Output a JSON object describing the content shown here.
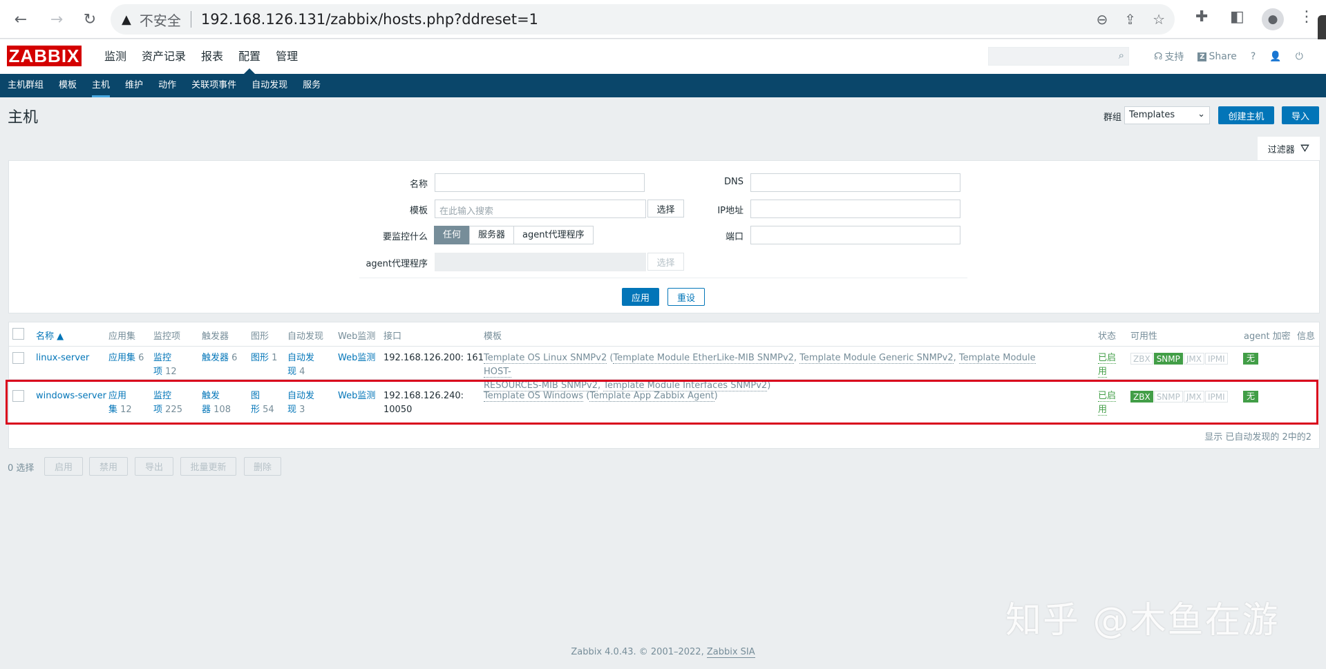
{
  "browser": {
    "insecure_label": "不安全",
    "url": "192.168.126.131/zabbix/hosts.php?ddreset=1"
  },
  "header": {
    "logo": "ZABBIX",
    "menu": [
      "监测",
      "资产记录",
      "报表",
      "配置",
      "管理"
    ],
    "active_menu": "配置",
    "links": {
      "support": "支持",
      "share": "Share",
      "help": "?"
    }
  },
  "submenu": {
    "items": [
      "主机群组",
      "模板",
      "主机",
      "维护",
      "动作",
      "关联项事件",
      "自动发现",
      "服务"
    ],
    "active": "主机"
  },
  "page": {
    "title": "主机",
    "group_label": "群组",
    "group_value": "Templates",
    "create_button": "创建主机",
    "import_button": "导入"
  },
  "filter": {
    "tab_label": "过滤器",
    "name_label": "名称",
    "name_value": "",
    "template_label": "模板",
    "template_placeholder": "在此输入搜索",
    "select_label": "选择",
    "monitored_label": "要监控什么",
    "monitored_options": [
      "任何",
      "服务器",
      "agent代理程序"
    ],
    "monitored_selected": "任何",
    "proxy_label": "agent代理程序",
    "proxy_select_label": "选择",
    "dns_label": "DNS",
    "dns_value": "",
    "ip_label": "IP地址",
    "ip_value": "",
    "port_label": "端口",
    "port_value": "",
    "apply_button": "应用",
    "reset_button": "重设"
  },
  "table": {
    "columns": [
      "名称 ▲",
      "应用集",
      "监控项",
      "触发器",
      "图形",
      "自动发现",
      "Web监测",
      "接口",
      "模板",
      "状态",
      "可用性",
      "agent 加密",
      "信息"
    ],
    "rows": [
      {
        "name": "linux-server",
        "applications_label": "应用集",
        "applications_count": "6",
        "items_label_a": "监控",
        "items_label_b": "项",
        "items_count": "12",
        "triggers_label": "触发器",
        "triggers_count": "6",
        "graphs_label": "图形",
        "graphs_count": "1",
        "discovery_label_a": "自动发",
        "discovery_label_b": "现",
        "discovery_count": "4",
        "web": "Web监测",
        "interface_line1": "192.168.126.200: 161",
        "interface_line2": "",
        "template_main": "Template OS Linux SNMPv2",
        "template_sub_1": "Template Module EtherLike-MIB SNMPv2",
        "template_sub_2": "Template Module Generic SNMPv2",
        "template_sub_3a": "Template Module HOST-",
        "template_sub_3b": "RESOURCES-MIB SNMPv2",
        "template_sub_4": "Template Module Interfaces SNMPv2",
        "status_a": "已启",
        "status_b": "用",
        "availability": [
          {
            "label": "ZBX",
            "on": false
          },
          {
            "label": "SNMP",
            "on": true
          },
          {
            "label": "JMX",
            "on": false
          },
          {
            "label": "IPMI",
            "on": false
          }
        ],
        "encryption": "无"
      },
      {
        "name": "windows-server",
        "applications_label_a": "应用",
        "applications_label_b": "集",
        "applications_count": "12",
        "items_label_a": "监控",
        "items_label_b": "项",
        "items_count": "225",
        "triggers_label_a": "触发",
        "triggers_label_b": "器",
        "triggers_count": "108",
        "graphs_label_a": "图",
        "graphs_label_b": "形",
        "graphs_count": "54",
        "discovery_label_a": "自动发",
        "discovery_label_b": "现",
        "discovery_count": "3",
        "web": "Web监测",
        "interface_line1": "192.168.126.240:",
        "interface_line2": "10050",
        "template_main": "Template OS Windows",
        "template_sub_1": "Template App Zabbix Agent",
        "status_a": "已启",
        "status_b": "用",
        "availability": [
          {
            "label": "ZBX",
            "on": true
          },
          {
            "label": "SNMP",
            "on": false
          },
          {
            "label": "JMX",
            "on": false
          },
          {
            "label": "IPMI",
            "on": false
          }
        ],
        "encryption": "无"
      }
    ],
    "footer": "显示 已自动发现的 2中的2"
  },
  "mass_actions": {
    "selected": "0 选择",
    "buttons": [
      "启用",
      "禁用",
      "导出",
      "批量更新",
      "删除"
    ]
  },
  "footer": {
    "text": "Zabbix 4.0.43. © 2001–2022,",
    "link": "Zabbix SIA"
  },
  "watermark": "知乎 @木鱼在游"
}
